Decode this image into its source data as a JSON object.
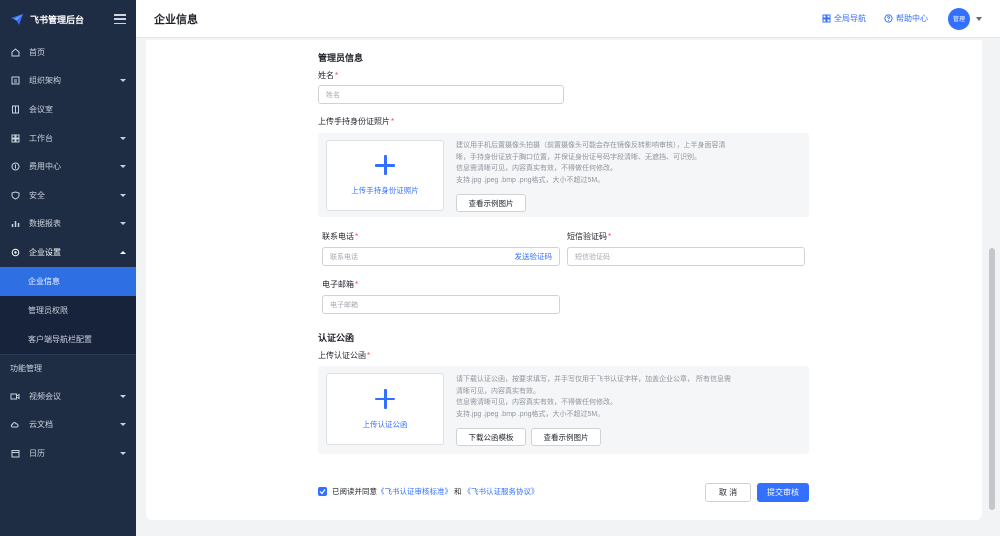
{
  "app": {
    "title": "飞书管理后台"
  },
  "sidebar": {
    "items": [
      {
        "label": "首页",
        "icon": "home-icon"
      },
      {
        "label": "组织架构",
        "icon": "org-icon"
      },
      {
        "label": "会议室",
        "icon": "room-icon"
      },
      {
        "label": "工作台",
        "icon": "grid-icon"
      },
      {
        "label": "费用中心",
        "icon": "cost-icon"
      },
      {
        "label": "安全",
        "icon": "shield-icon"
      },
      {
        "label": "数据报表",
        "icon": "chart-icon"
      },
      {
        "label": "企业设置",
        "icon": "gear-icon"
      }
    ],
    "sub_items": [
      {
        "label": "企业信息",
        "active": true
      },
      {
        "label": "管理员权限",
        "active": false
      },
      {
        "label": "客户端导航栏配置",
        "active": false
      }
    ],
    "section_label": "功能管理",
    "func_items": [
      {
        "label": "视频会议",
        "icon": "video-icon"
      },
      {
        "label": "云文档",
        "icon": "cloud-doc-icon"
      },
      {
        "label": "日历",
        "icon": "calendar-icon"
      }
    ]
  },
  "header": {
    "title": "企业信息",
    "global_nav": "全局导航",
    "help_center": "帮助中心",
    "avatar_text": "管理"
  },
  "form": {
    "admin_section": "管理员信息",
    "name_label": "姓名",
    "name_placeholder": "姓名",
    "id_upload_label": "上传手持身份证照片",
    "id_upload_text": "上传手持身份证照片",
    "id_tips": [
      "建议用手机后置摄像头拍摄（前置摄像头可能会存在镜像反转影响审核），上半身面容清",
      "晰，手持身份证放于胸口位置，并保证身份证号码字段清晰、无遮挡、可识别。",
      "信息需清晰可见，内容真实有效，不得做任何修改。",
      "支持.jpg .jpeg .bmp .png格式，大小不超过5M。"
    ],
    "id_example_btn": "查看示例图片",
    "phone_label": "联系电话",
    "phone_placeholder": "联系电话",
    "send_code": "发送验证码",
    "sms_label": "短信验证码",
    "sms_placeholder": "短信验证码",
    "email_label": "电子邮箱",
    "email_placeholder": "电子邮箱",
    "cert_section": "认证公函",
    "cert_upload_label": "上传认证公函",
    "cert_upload_text": "上传认证公函",
    "cert_tips": [
      "请下载认证公函，按要求填写，并手写仅用于飞书认证字样，加盖企业公章， 所有信息需",
      "清晰可见，内容真实有效。",
      "信息需清晰可见，内容真实有效，不得做任何修改。",
      "支持.jpg .jpeg .bmp .png格式，大小不超过5M。"
    ],
    "download_template_btn": "下载公函模板",
    "cert_example_btn": "查看示例图片",
    "agree_prefix": "已阅读并同意",
    "agree_link1": "《飞书认证审核标准》",
    "agree_and": "和",
    "agree_link2": "《飞书认证服务协议》",
    "cancel_btn": "取 消",
    "submit_btn": "提交审核"
  },
  "colors": {
    "accent": "#3370ff",
    "sidebar_bg": "#1f2d44",
    "active_bg": "#2f6fe4"
  }
}
